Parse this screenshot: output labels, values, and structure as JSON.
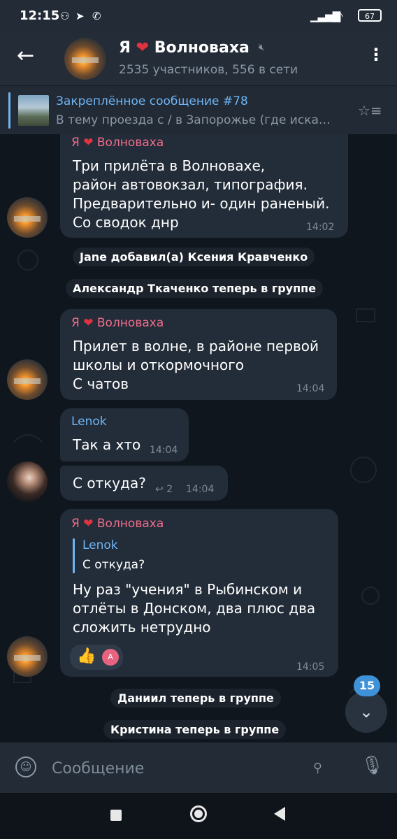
{
  "status_bar": {
    "time": "12:15",
    "battery": "67"
  },
  "header": {
    "title_prefix": "Я",
    "title_heart": "❤",
    "title_suffix": "Волноваха",
    "subtitle": "2535 участников, 556 в сети"
  },
  "pinned": {
    "title": "Закреплённое сообщение #78",
    "text": "В тему проезда с / в Запорожье (где иска…"
  },
  "messages": [
    {
      "sender_prefix": "Я",
      "sender_heart": "❤",
      "sender_suffix": "Волноваха",
      "lines": [
        "Три прилёта в Волновахе,",
        "район автовокзал, типография.",
        "Предварительно и- один раненый.",
        "Со сводок днр"
      ],
      "time": "14:02"
    },
    {
      "sender_prefix": "Я",
      "sender_heart": "❤",
      "sender_suffix": "Волноваха",
      "lines": [
        "Прилет в волне, в районе первой",
        "школы и откормочного",
        "С чатов"
      ],
      "time": "14:04"
    },
    {
      "sender": "Lenok",
      "text": "Так а хто",
      "time": "14:04"
    },
    {
      "text": "С откуда?",
      "replies": "2",
      "time": "14:04"
    },
    {
      "sender_prefix": "Я",
      "sender_heart": "❤",
      "sender_suffix": "Волноваха",
      "reply_author": "Lenok",
      "reply_text": "С откуда?",
      "lines": [
        "Ну раз \"учения\" в Рыбинском и",
        "отлёты в Донском, два плюс два",
        "сложить нетрудно"
      ],
      "reaction": "👍",
      "reaction_avatar": "A",
      "time": "14:05"
    }
  ],
  "service": {
    "added": "Jane добавил(а) Ксения Кравченко",
    "joined1": "Александр Ткаченко теперь в группе",
    "joined2": "Даниил теперь в группе",
    "joined3": "Кристина теперь в группе"
  },
  "scroll": {
    "unread": "15"
  },
  "input": {
    "placeholder": "Сообщение"
  }
}
